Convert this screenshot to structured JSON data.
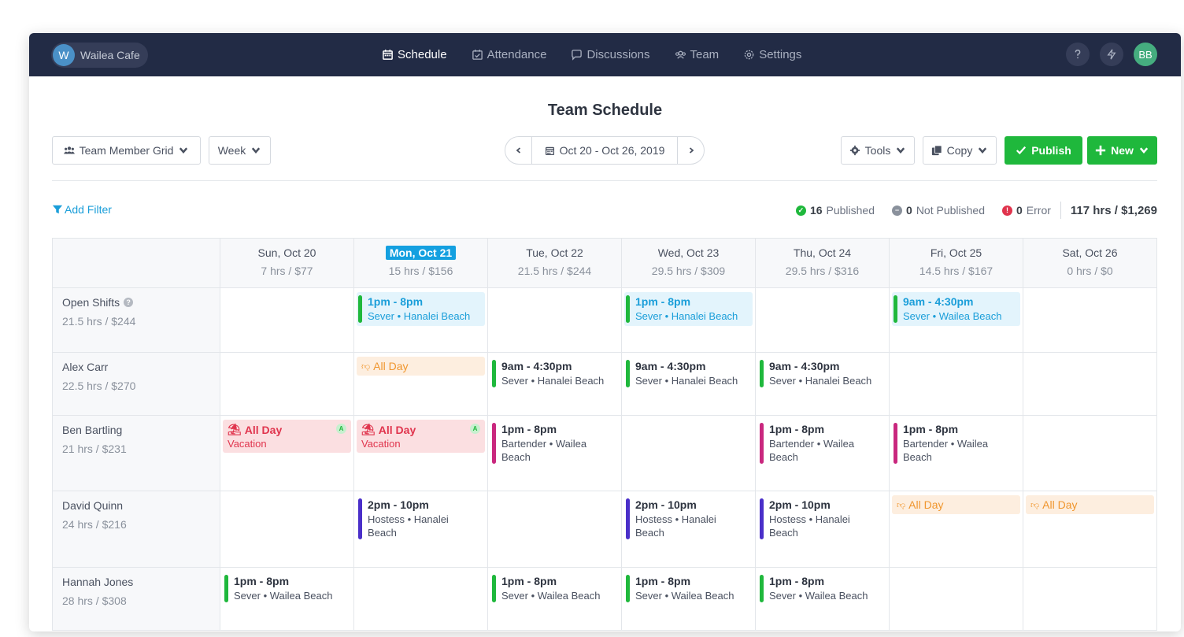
{
  "company": {
    "initial": "W",
    "name": "Wailea Cafe"
  },
  "nav": [
    {
      "label": "Schedule",
      "icon": "calendar-icon",
      "active": true
    },
    {
      "label": "Attendance",
      "icon": "calendar-check-icon",
      "active": false
    },
    {
      "label": "Discussions",
      "icon": "chat-icon",
      "active": false
    },
    {
      "label": "Team",
      "icon": "team-icon",
      "active": false
    },
    {
      "label": "Settings",
      "icon": "gear-icon",
      "active": false
    }
  ],
  "user": {
    "initials": "BB"
  },
  "page_title": "Team Schedule",
  "toolbar": {
    "view_label": "Team Member Grid",
    "period_label": "Week",
    "date_range": "Oct 20 - Oct 26, 2019",
    "tools_label": "Tools",
    "copy_label": "Copy",
    "publish_label": "Publish",
    "new_label": "New"
  },
  "filter": {
    "add_label": "Add Filter"
  },
  "stats": {
    "published_count": "16",
    "published_label": "Published",
    "not_published_count": "0",
    "not_published_label": "Not Published",
    "error_count": "0",
    "error_label": "Error",
    "total": "117 hrs / $1,269"
  },
  "colors": {
    "nav_bg": "#222b45",
    "accent": "#14a0e0",
    "green": "#1fb83c",
    "bartender": "#c9277e",
    "hostess": "#4a2fc9"
  },
  "days": [
    {
      "name": "Sun, Oct 20",
      "summary": "7 hrs / $77",
      "today": false
    },
    {
      "name": "Mon, Oct 21",
      "summary": "15 hrs / $156",
      "today": true
    },
    {
      "name": "Tue, Oct 22",
      "summary": "21.5 hrs / $244",
      "today": false
    },
    {
      "name": "Wed, Oct 23",
      "summary": "29.5 hrs / $309",
      "today": false
    },
    {
      "name": "Thu, Oct 24",
      "summary": "29.5 hrs / $316",
      "today": false
    },
    {
      "name": "Fri, Oct 25",
      "summary": "14.5 hrs / $167",
      "today": false
    },
    {
      "name": "Sat, Oct 26",
      "summary": "0 hrs / $0",
      "today": false
    }
  ],
  "rows": [
    {
      "name": "Open Shifts",
      "summary": "21.5 hrs / $244",
      "help": true,
      "height": 82,
      "cells": [
        null,
        {
          "kind": "open",
          "time": "1pm - 8pm",
          "detail": "Sever • Hanalei Beach",
          "color": "#1fb83c"
        },
        null,
        {
          "kind": "open",
          "time": "1pm - 8pm",
          "detail": "Sever • Hanalei Beach",
          "color": "#1fb83c"
        },
        null,
        {
          "kind": "open",
          "time": "9am - 4:30pm",
          "detail": "Sever • Wailea Beach",
          "color": "#1fb83c"
        },
        null
      ]
    },
    {
      "name": "Alex Carr",
      "summary": "22.5 hrs / $270",
      "height": 80,
      "cells": [
        null,
        {
          "kind": "unavail",
          "label": "All Day"
        },
        {
          "kind": "shift",
          "time": "9am - 4:30pm",
          "detail": "Sever • Hanalei Beach",
          "color": "#1fb83c"
        },
        {
          "kind": "shift",
          "time": "9am - 4:30pm",
          "detail": "Sever • Hanalei Beach",
          "color": "#1fb83c"
        },
        {
          "kind": "shift",
          "time": "9am - 4:30pm",
          "detail": "Sever • Hanalei Beach",
          "color": "#1fb83c"
        },
        null,
        null
      ]
    },
    {
      "name": "Ben Bartling",
      "summary": "21 hrs / $231",
      "height": 96,
      "cells": [
        {
          "kind": "vacation",
          "label": "All Day",
          "detail": "Vacation",
          "badge": "A"
        },
        {
          "kind": "vacation",
          "label": "All Day",
          "detail": "Vacation",
          "badge": "A"
        },
        {
          "kind": "shift",
          "time": "1pm - 8pm",
          "detail": "Bartender • Wailea Beach",
          "color": "#c9277e"
        },
        null,
        {
          "kind": "shift",
          "time": "1pm - 8pm",
          "detail": "Bartender • Wailea Beach",
          "color": "#c9277e"
        },
        {
          "kind": "shift",
          "time": "1pm - 8pm",
          "detail": "Bartender • Wailea Beach",
          "color": "#c9277e"
        },
        null
      ]
    },
    {
      "name": "David Quinn",
      "summary": "24 hrs / $216",
      "height": 97,
      "cells": [
        null,
        {
          "kind": "shift",
          "time": "2pm - 10pm",
          "detail": "Hostess • Hanalei Beach",
          "color": "#4a2fc9"
        },
        null,
        {
          "kind": "shift",
          "time": "2pm - 10pm",
          "detail": "Hostess • Hanalei Beach",
          "color": "#4a2fc9"
        },
        {
          "kind": "shift",
          "time": "2pm - 10pm",
          "detail": "Hostess • Hanalei Beach",
          "color": "#4a2fc9"
        },
        {
          "kind": "unavail",
          "label": "All Day"
        },
        {
          "kind": "unavail",
          "label": "All Day"
        }
      ]
    },
    {
      "name": "Hannah Jones",
      "summary": "28 hrs / $308",
      "height": 80,
      "cells": [
        {
          "kind": "shift",
          "time": "1pm - 8pm",
          "detail": "Sever • Wailea Beach",
          "color": "#1fb83c"
        },
        null,
        {
          "kind": "shift",
          "time": "1pm - 8pm",
          "detail": "Sever • Wailea Beach",
          "color": "#1fb83c"
        },
        {
          "kind": "shift",
          "time": "1pm - 8pm",
          "detail": "Sever • Wailea Beach",
          "color": "#1fb83c"
        },
        {
          "kind": "shift",
          "time": "1pm - 8pm",
          "detail": "Sever • Wailea Beach",
          "color": "#1fb83c"
        },
        null,
        null
      ]
    }
  ]
}
